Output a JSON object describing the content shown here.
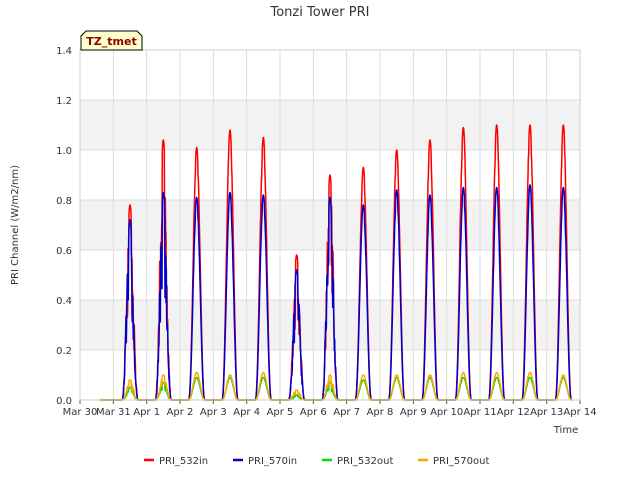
{
  "chart_data": {
    "type": "line",
    "title": "Tonzi Tower PRI",
    "xlabel": "Time",
    "ylabel": "PRI Channel (W/m2/nm)",
    "ylim": [
      0,
      1.4
    ],
    "yticks": [
      "0.0",
      "0.2",
      "0.4",
      "0.6",
      "0.8",
      "1.0",
      "1.2",
      "1.4"
    ],
    "xlim_days": [
      0,
      15
    ],
    "xticks": [
      "Mar 30",
      "Mar 31",
      "Apr 1",
      "Apr 2",
      "Apr 3",
      "Apr 4",
      "Apr 5",
      "Apr 6",
      "Apr 7",
      "Apr 8",
      "Apr 9",
      "Apr 10",
      "Apr 11",
      "Apr 12",
      "Apr 13",
      "Apr 14"
    ],
    "grid": true,
    "legend_position": "bottom",
    "annotation": "TZ_tmet",
    "peak_days": [
      "Mar 31",
      "Apr 1",
      "Apr 2",
      "Apr 3",
      "Apr 4",
      "Apr 5",
      "Apr 6",
      "Apr 7",
      "Apr 8",
      "Apr 9",
      "Apr 10",
      "Apr 11",
      "Apr 12",
      "Apr 13"
    ],
    "series": [
      {
        "name": "PRI_532in",
        "color": "#ff0000",
        "daily_peak": [
          0.78,
          1.04,
          1.01,
          1.08,
          1.05,
          0.58,
          0.9,
          0.93,
          1.0,
          1.04,
          1.09,
          1.1,
          1.1,
          1.1
        ]
      },
      {
        "name": "PRI_570in",
        "color": "#0000cc",
        "daily_peak": [
          0.72,
          0.83,
          0.81,
          0.83,
          0.82,
          0.52,
          0.81,
          0.78,
          0.84,
          0.82,
          0.85,
          0.85,
          0.86,
          0.85
        ]
      },
      {
        "name": "PRI_532out",
        "color": "#00dd00",
        "daily_peak": [
          0.05,
          0.07,
          0.09,
          0.09,
          0.09,
          0.02,
          0.07,
          0.08,
          0.09,
          0.09,
          0.09,
          0.09,
          0.09,
          0.09
        ]
      },
      {
        "name": "PRI_570out",
        "color": "#ffa500",
        "daily_peak": [
          0.08,
          0.1,
          0.11,
          0.1,
          0.11,
          0.04,
          0.1,
          0.1,
          0.1,
          0.1,
          0.11,
          0.11,
          0.11,
          0.1
        ]
      }
    ]
  }
}
